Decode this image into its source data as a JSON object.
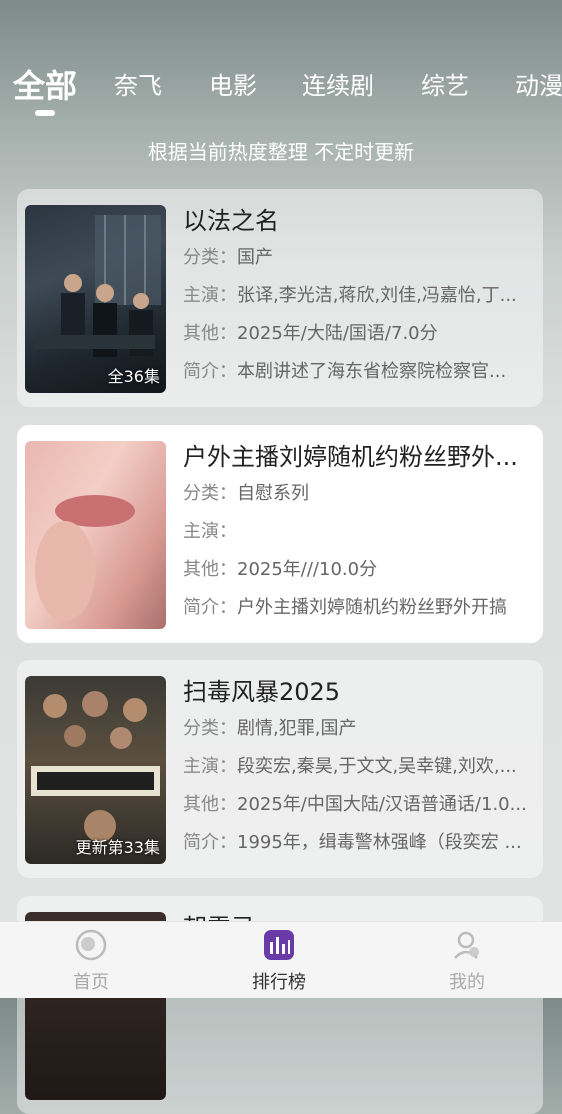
{
  "tabs": [
    {
      "label": "全部",
      "active": true
    },
    {
      "label": "奈飞",
      "active": false
    },
    {
      "label": "电影",
      "active": false
    },
    {
      "label": "连续剧",
      "active": false
    },
    {
      "label": "综艺",
      "active": false
    },
    {
      "label": "动漫",
      "active": false
    }
  ],
  "subtitle": "根据当前热度整理 不定时更新",
  "items": [
    {
      "title": "以法之名",
      "category_label": "分类：",
      "category": "国产",
      "cast_label": "主演：",
      "cast": "张译,李光洁,蒋欣,刘佳,冯嘉怡,丁...",
      "other_label": "其他：",
      "other": "2025年/大陆/国语/7.0分",
      "intro_label": "简介：",
      "intro": "本剧讲述了海东省检察院检察官...",
      "badge": "全36集"
    },
    {
      "title": "户外主播刘婷随机约粉丝野外...",
      "category_label": "分类：",
      "category": "自慰系列",
      "cast_label": "主演：",
      "cast": "",
      "other_label": "其他：",
      "other": "2025年///10.0分",
      "intro_label": "简介：",
      "intro": "户外主播刘婷随机约粉丝野外开搞",
      "badge": ""
    },
    {
      "title": "扫毒风暴2025",
      "category_label": "分类：",
      "category": "剧情,犯罪,国产",
      "cast_label": "主演：",
      "cast": "段奕宏,秦昊,于文文,吴幸键,刘欢,...",
      "other_label": "其他：",
      "other": "2025年/中国大陆/汉语普通话/1.0...",
      "intro_label": "简介：",
      "intro": "1995年，缉毒警林强峰（段奕宏 ...",
      "badge": "更新第33集"
    },
    {
      "title": "朝雪录",
      "category_label": "",
      "category": "",
      "cast_label": "",
      "cast": "",
      "other_label": "",
      "other": "",
      "intro_label": "",
      "intro": "",
      "badge": ""
    }
  ],
  "tabbar": [
    {
      "label": "首页",
      "icon": "home-icon",
      "active": false
    },
    {
      "label": "排行榜",
      "icon": "ranking-icon",
      "active": true
    },
    {
      "label": "我的",
      "icon": "profile-icon",
      "active": false
    }
  ],
  "colors": {
    "active_tab_bar": "#6a3aa8",
    "text": "#222222",
    "muted": "#888888"
  }
}
